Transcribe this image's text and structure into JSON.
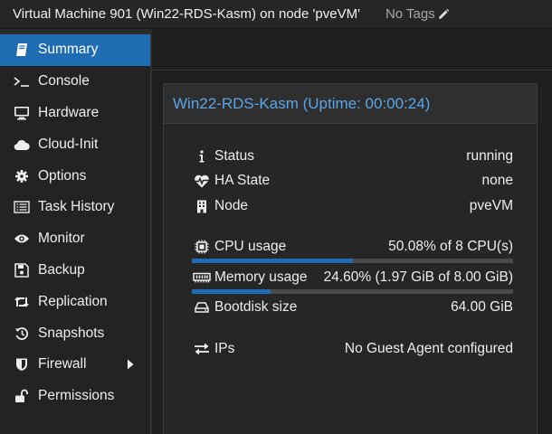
{
  "header": {
    "title": "Virtual Machine 901 (Win22-RDS-Kasm) on node 'pveVM'",
    "tags_label": "No Tags"
  },
  "sidebar": {
    "items": [
      {
        "label": "Summary",
        "icon": "book-icon",
        "active": true
      },
      {
        "label": "Console",
        "icon": "terminal-icon"
      },
      {
        "label": "Hardware",
        "icon": "monitor-icon"
      },
      {
        "label": "Cloud-Init",
        "icon": "cloud-icon"
      },
      {
        "label": "Options",
        "icon": "gear-icon"
      },
      {
        "label": "Task History",
        "icon": "list-icon"
      },
      {
        "label": "Monitor",
        "icon": "eye-icon"
      },
      {
        "label": "Backup",
        "icon": "floppy-icon"
      },
      {
        "label": "Replication",
        "icon": "retweet-icon"
      },
      {
        "label": "Snapshots",
        "icon": "history-icon"
      },
      {
        "label": "Firewall",
        "icon": "shield-icon",
        "has_submenu": true
      },
      {
        "label": "Permissions",
        "icon": "unlock-icon"
      }
    ]
  },
  "panel": {
    "title": "Win22-RDS-Kasm (Uptime: 00:00:24)",
    "status": {
      "label": "Status",
      "value": "running"
    },
    "ha_state": {
      "label": "HA State",
      "value": "none"
    },
    "node": {
      "label": "Node",
      "value": "pveVM"
    },
    "cpu": {
      "label": "CPU usage",
      "value": "50.08% of 8 CPU(s)",
      "fraction": 0.5008
    },
    "memory": {
      "label": "Memory usage",
      "value": "24.60% (1.97 GiB of 8.00 GiB)",
      "fraction": 0.246
    },
    "bootdisk": {
      "label": "Bootdisk size",
      "value": "64.00 GiB"
    },
    "ips": {
      "label": "IPs",
      "value": "No Guest Agent configured"
    }
  },
  "colors": {
    "accent": "#1f6cb3",
    "title_blue": "#5aa6e8"
  }
}
